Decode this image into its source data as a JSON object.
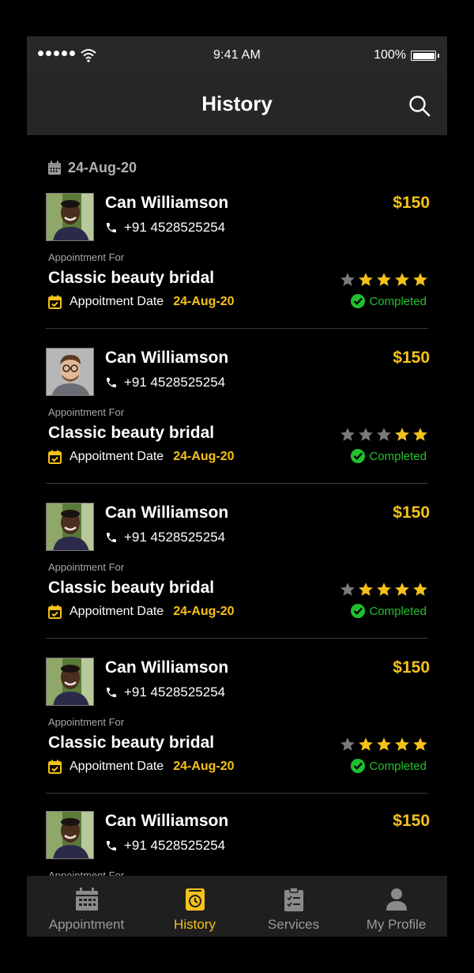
{
  "status_bar": {
    "time": "9:41 AM",
    "battery": "100%"
  },
  "header": {
    "title": "History",
    "search_icon": "search-icon"
  },
  "date_group": {
    "date": "24-Aug-20",
    "icon": "calendar-icon"
  },
  "appointments": [
    {
      "name": "Can Williamson",
      "phone": "+91 4528525254",
      "price": "$150",
      "appt_label": "Appointment For",
      "service": "Classic beauty bridal",
      "date_label": "Appoitment Date",
      "date": "24-Aug-20",
      "rating": 4,
      "status": "Completed",
      "avatar": "man-smiling-avatar"
    },
    {
      "name": "Can Williamson",
      "phone": "+91 4528525254",
      "price": "$150",
      "appt_label": "Appointment For",
      "service": "Classic beauty bridal",
      "date_label": "Appoitment Date",
      "date": "24-Aug-20",
      "rating": 2,
      "status": "Completed",
      "avatar": "man-glasses-avatar"
    },
    {
      "name": "Can Williamson",
      "phone": "+91 4528525254",
      "price": "$150",
      "appt_label": "Appointment For",
      "service": "Classic beauty bridal",
      "date_label": "Appoitment Date",
      "date": "24-Aug-20",
      "rating": 4,
      "status": "Completed",
      "avatar": "man-smiling-avatar"
    },
    {
      "name": "Can Williamson",
      "phone": "+91 4528525254",
      "price": "$150",
      "appt_label": "Appointment For",
      "service": "Classic beauty bridal",
      "date_label": "Appoitment Date",
      "date": "24-Aug-20",
      "rating": 4,
      "status": "Completed",
      "avatar": "man-smiling-avatar"
    },
    {
      "name": "Can Williamson",
      "phone": "+91 4528525254",
      "price": "$150",
      "appt_label": "Appointment For",
      "service": "",
      "date_label": "",
      "date": "",
      "rating": null,
      "status": "",
      "avatar": "man-smiling-avatar"
    }
  ],
  "tabs": [
    {
      "label": "Appointment",
      "icon": "calendar-icon",
      "active": false
    },
    {
      "label": "History",
      "icon": "history-icon",
      "active": true
    },
    {
      "label": "Services",
      "icon": "clipboard-icon",
      "active": false
    },
    {
      "label": "My Profile",
      "icon": "user-icon",
      "active": false
    }
  ],
  "colors": {
    "accent": "#f5c21a",
    "status_completed": "#22c02c",
    "star_empty": "#7a7a7a",
    "header_bg": "#262626",
    "tabbar_bg": "#1f1f1f"
  }
}
